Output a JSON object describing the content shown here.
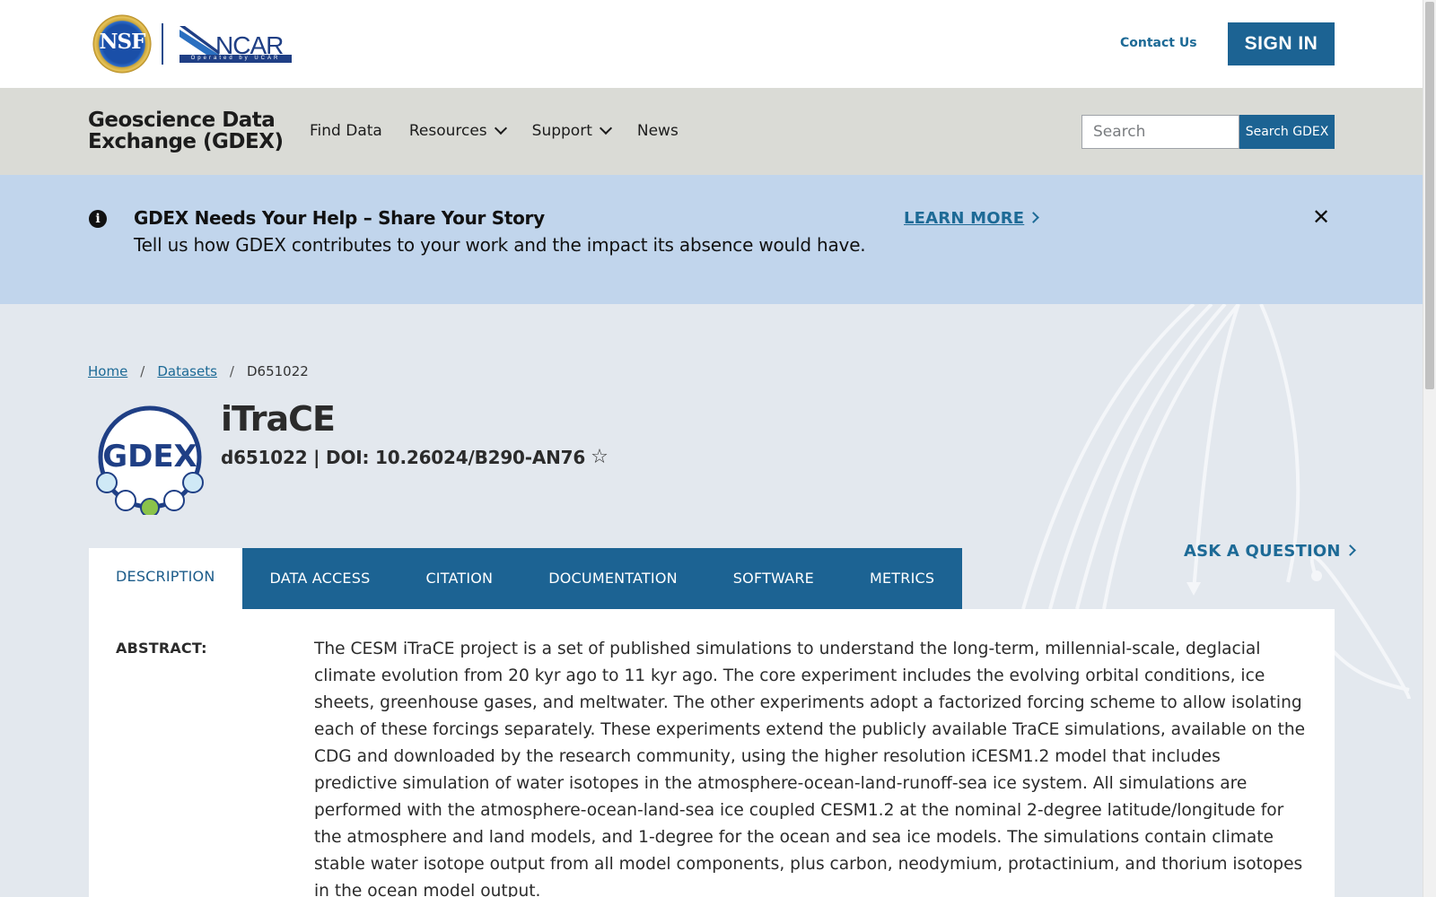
{
  "header": {
    "nsf_logo_text": "NSF",
    "ncar_logo_text": "NCAR",
    "ncar_logo_sub": "Operated by UCAR",
    "contact_label": "Contact Us",
    "signin_label": "SIGN IN"
  },
  "nav": {
    "site_title_line1": "Geoscience Data",
    "site_title_line2": "Exchange (GDEX)",
    "items": [
      {
        "label": "Find Data",
        "has_dropdown": false
      },
      {
        "label": "Resources",
        "has_dropdown": true
      },
      {
        "label": "Support",
        "has_dropdown": true
      },
      {
        "label": "News",
        "has_dropdown": false
      }
    ],
    "search_placeholder": "Search",
    "search_button": "Search GDEX"
  },
  "alert": {
    "icon": "info-icon",
    "title": "GDEX Needs Your Help – Share Your Story",
    "body": "Tell us how GDEX contributes to your work and the impact its absence would have.",
    "link_label": "LEARN MORE",
    "close_icon": "close-icon"
  },
  "breadcrumb": {
    "home": "Home",
    "datasets": "Datasets",
    "current": "D651022"
  },
  "dataset": {
    "logo_text": "GDEX",
    "title": "iTraCE",
    "subtitle": "d651022 | DOI: 10.26024/B290-AN76",
    "favorite_icon": "star-icon"
  },
  "tabs": [
    {
      "label": "DESCRIPTION",
      "active": true
    },
    {
      "label": "DATA ACCESS",
      "active": false
    },
    {
      "label": "CITATION",
      "active": false
    },
    {
      "label": "DOCUMENTATION",
      "active": false
    },
    {
      "label": "SOFTWARE",
      "active": false
    },
    {
      "label": "METRICS",
      "active": false
    }
  ],
  "ask_label": "ASK A QUESTION",
  "abstract": {
    "label": "ABSTRACT:",
    "text": "The CESM iTraCE project is a set of published simulations to understand the long-term, millennial-scale, deglacial climate evolution from 20 kyr ago to 11 kyr ago. The core experiment includes the evolving orbital conditions, ice sheets, greenhouse gases, and meltwater. The other experiments adopt a factorized forcing scheme to allow isolating each of these forcings separately. These experiments extend the publicly available TraCE simulations, available on the CDG and downloaded by the research community, using the higher resolution iCESM1.2 model that includes predictive simulation of water isotopes in the atmosphere-ocean-land-runoff-sea ice system. All simulations are performed with the atmosphere-ocean-land-sea ice coupled CESM1.2 at the nominal 2-degree latitude/longitude for the atmosphere and land models, and 1-degree for the ocean and sea ice models. The simulations contain climate stable water isotope output from all model components, plus carbon, neodymium, protactinium, and thorium isotopes in the ocean model output."
  },
  "colors": {
    "primary": "#1c6393",
    "link": "#1d6a96",
    "nav_bg": "#dadbd6",
    "alert_bg": "#c1d5ec",
    "page_bg": "#e3e8ee"
  }
}
